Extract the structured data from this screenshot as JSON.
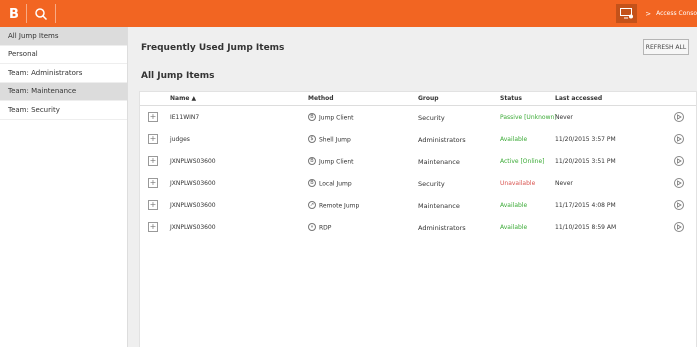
{
  "header": {
    "logo_letter": "B",
    "console_link": "Access Conso",
    "chevron": ">"
  },
  "sidebar": {
    "items": [
      {
        "label": "All Jump Items",
        "active": true
      },
      {
        "label": "Personal",
        "active": false
      },
      {
        "label": "Team: Administrators",
        "active": false
      },
      {
        "label": "Team: Maintenance",
        "active": true
      },
      {
        "label": "Team: Security",
        "active": false
      }
    ]
  },
  "main": {
    "frequent_title": "Frequently Used Jump Items",
    "refresh_label": "REFRESH ALL",
    "all_title": "All Jump Items",
    "columns": {
      "name": "Name ▲",
      "method": "Method",
      "group": "Group",
      "status": "Status",
      "last": "Last accessed"
    },
    "rows": [
      {
        "name": "IE11WIN7",
        "method": "Jump Client",
        "method_icon": "jump-client-icon",
        "group": "Security",
        "status": "Passive [Unknown]",
        "status_color": "#3aaa35",
        "last": "Never"
      },
      {
        "name": "judges",
        "method": "Shell Jump",
        "method_icon": "shell-jump-icon",
        "group": "Administrators",
        "status": "Available",
        "status_color": "#3aaa35",
        "last": "11/20/2015 3:57 PM"
      },
      {
        "name": "JXNPLWS03600",
        "method": "Jump Client",
        "method_icon": "jump-client-icon",
        "group": "Maintenance",
        "status": "Active [Online]",
        "status_color": "#3aaa35",
        "last": "11/20/2015 3:51 PM"
      },
      {
        "name": "JXNPLWS03600",
        "method": "Local Jump",
        "method_icon": "local-jump-icon",
        "group": "Security",
        "status": "Unavailable",
        "status_color": "#d9534f",
        "last": "Never"
      },
      {
        "name": "JXNPLWS03600",
        "method": "Remote Jump",
        "method_icon": "remote-jump-icon",
        "group": "Maintenance",
        "status": "Available",
        "status_color": "#3aaa35",
        "last": "11/17/2015 4:08 PM"
      },
      {
        "name": "JXNPLWS03600",
        "method": "RDP",
        "method_icon": "rdp-icon",
        "group": "Administrators",
        "status": "Available",
        "status_color": "#3aaa35",
        "last": "11/10/2015 8:59 AM"
      }
    ]
  },
  "colors": {
    "brand": "#f26522",
    "status_green": "#3aaa35",
    "status_red": "#d9534f"
  }
}
